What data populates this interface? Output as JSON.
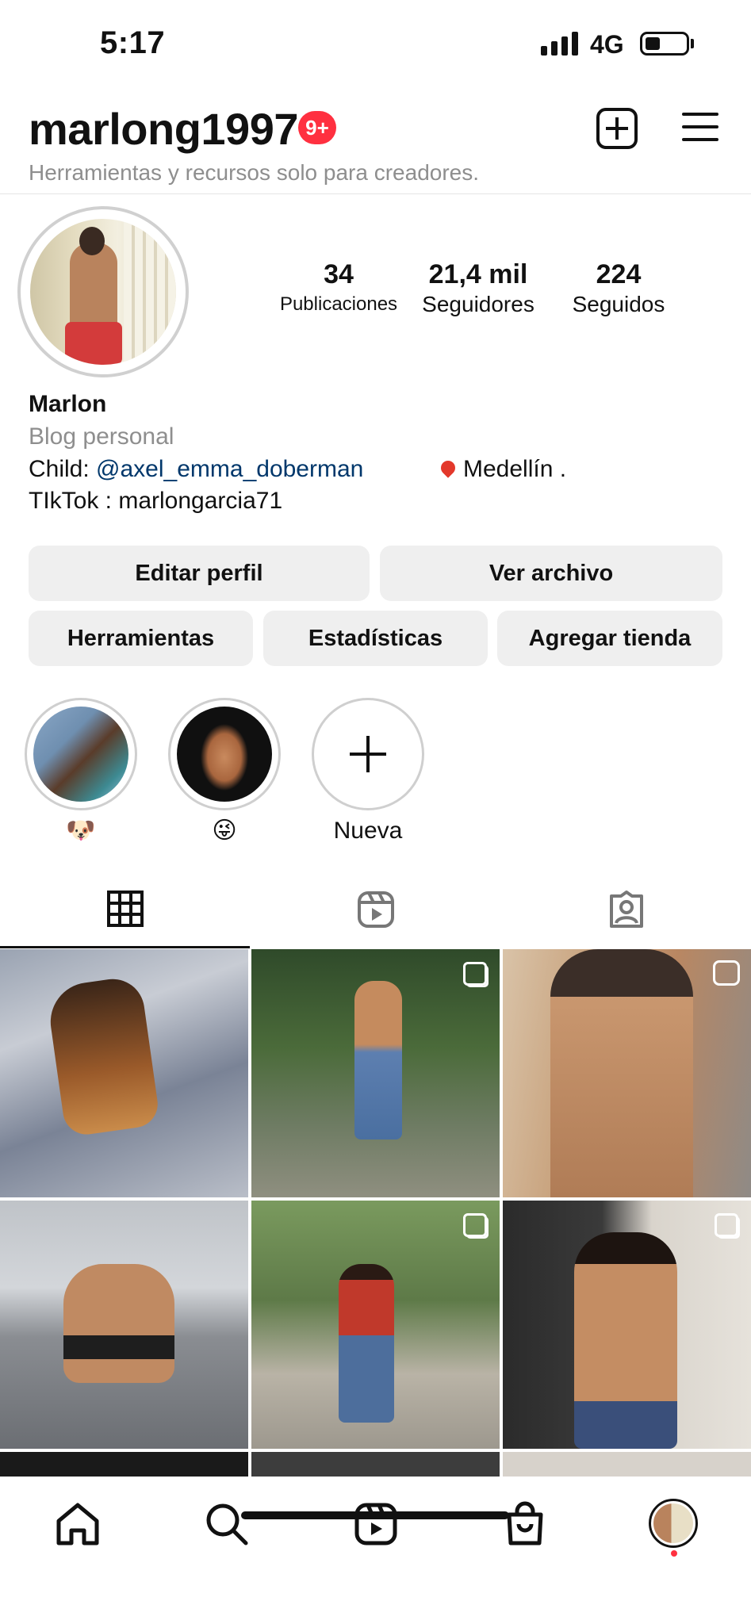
{
  "status_bar": {
    "time": "5:17",
    "network": "4G"
  },
  "header": {
    "username": "marlong1997",
    "notification_badge": "9+",
    "subtitle": "Herramientas y recursos solo para creadores."
  },
  "profile": {
    "stats": [
      {
        "value": "34",
        "label": "Publicaciones"
      },
      {
        "value": "21,4 mil",
        "label": "Seguidores"
      },
      {
        "value": "224",
        "label": "Seguidos"
      }
    ],
    "name": "Marlon",
    "category": "Blog personal",
    "bio_child_prefix": "Child: ",
    "bio_child_link": "@axel_emma_doberman",
    "bio_location": "Medellín .",
    "bio_tiktok": "TIkTok : marlongarcia71"
  },
  "buttons": {
    "edit_profile": "Editar perfil",
    "archive": "Ver archivo",
    "tools": "Herramientas",
    "insights": "Estadísticas",
    "add_shop": "Agregar tienda"
  },
  "highlights": [
    {
      "label": "🐶"
    },
    {
      "label": "😜"
    },
    {
      "label": "Nueva"
    }
  ],
  "tabs": [
    "posts-grid",
    "reels",
    "tagged"
  ],
  "nav": [
    "home",
    "search",
    "reels",
    "shop",
    "profile"
  ],
  "colors": {
    "accent_red": "#ff3040",
    "link": "#00376b",
    "button_bg": "#efefef"
  }
}
